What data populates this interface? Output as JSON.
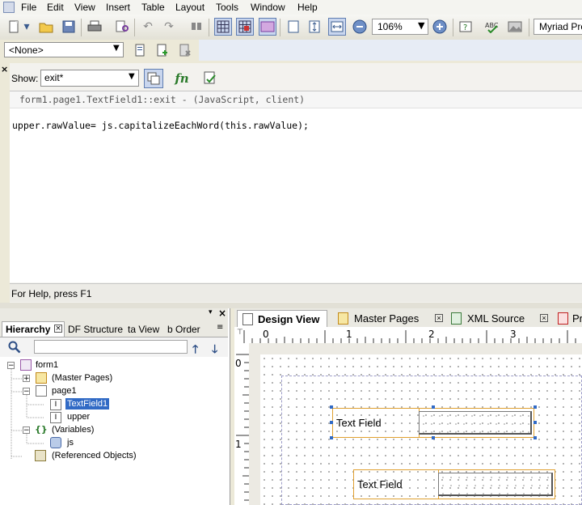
{
  "menubar": {
    "items": [
      "File",
      "Edit",
      "View",
      "Insert",
      "Table",
      "Layout",
      "Tools",
      "Window",
      "Help"
    ]
  },
  "toolbar": {
    "zoom_value": "106%",
    "font_value": "Myriad Pro"
  },
  "object_toolbar": {
    "select_value": "<None>"
  },
  "script_editor": {
    "show_label": "Show:",
    "show_value": "exit*",
    "function_icon_text": "fn",
    "header_line": "form1.page1.TextField1::exit - (JavaScript, client)",
    "code_line": "upper.rawValue= js.capitalizeEachWord(this.rawValue);",
    "status_text": "For Help, press F1"
  },
  "hierarchy": {
    "tabs": [
      "Hierarchy",
      "DF Structure",
      "ta View",
      "b Order"
    ],
    "tree": [
      {
        "label": "form1",
        "level": 0,
        "icon": "form-icon"
      },
      {
        "label": "(Master Pages)",
        "level": 1,
        "icon": "master-pages-icon"
      },
      {
        "label": "page1",
        "level": 1,
        "icon": "page-icon"
      },
      {
        "label": "TextField1",
        "level": 2,
        "icon": "textfield-icon",
        "selected": true
      },
      {
        "label": "upper",
        "level": 2,
        "icon": "textfield-icon"
      },
      {
        "label": "(Variables)",
        "level": 1,
        "icon": "variables-icon"
      },
      {
        "label": "js",
        "level": 2,
        "icon": "script-object-icon"
      },
      {
        "label": "(Referenced Objects)",
        "level": 1,
        "icon": "referenced-objects-icon"
      }
    ]
  },
  "design": {
    "tabs": [
      "Design View",
      "Master Pages",
      "XML Source",
      "Pr"
    ],
    "ruler_top": [
      "0",
      "1",
      "2",
      "3"
    ],
    "ruler_left": [
      "0",
      "1"
    ],
    "fields": [
      {
        "caption": "Text Field"
      },
      {
        "caption": "Text Field"
      }
    ]
  },
  "colors": {
    "selection": "#316ac5",
    "field_border": "#e0a030"
  }
}
